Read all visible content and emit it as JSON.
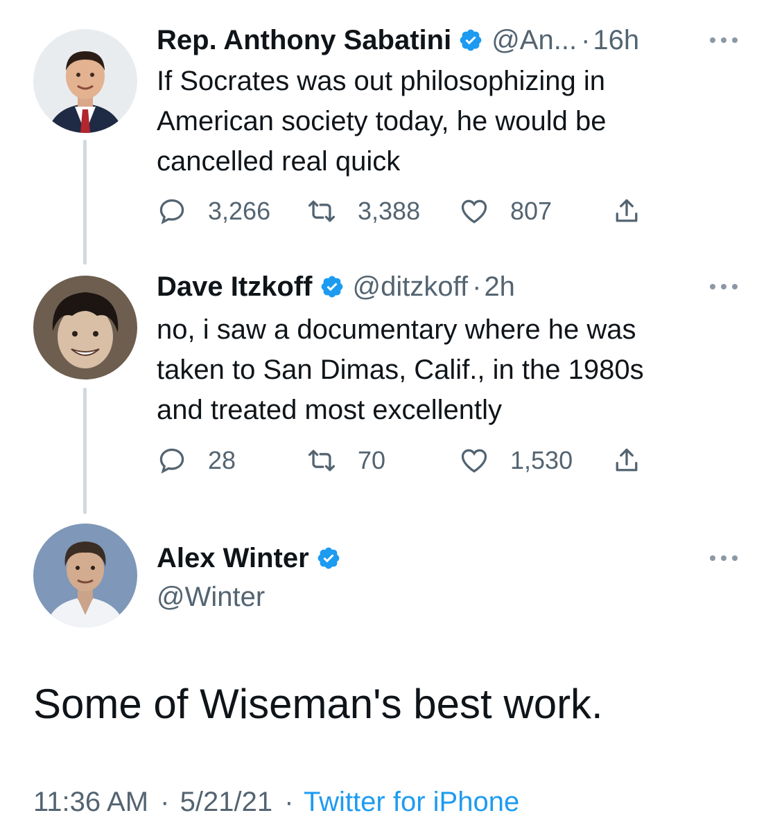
{
  "colors": {
    "verified": "#1d9bf0",
    "link": "#1d9bf0",
    "muted": "#536471",
    "thread_line": "#cfd9de"
  },
  "tweets": [
    {
      "name": "Rep. Anthony Sabatini",
      "handle": "@An...",
      "time": "16h",
      "text_lines": [
        "If Socrates was out philosophizing in",
        "American society today, he would be",
        "cancelled real quick"
      ],
      "replies": "3,266",
      "retweets": "3,388",
      "likes": "807"
    },
    {
      "name": "Dave Itzkoff",
      "handle": "@ditzkoff",
      "time": "2h",
      "text_lines": [
        "no, i saw a documentary where he was",
        "taken to San Dimas, Calif., in the 1980s",
        "and treated most excellently"
      ],
      "replies": "28",
      "retweets": "70",
      "likes": "1,530"
    }
  ],
  "main_tweet": {
    "name": "Alex Winter",
    "handle": "@Winter",
    "text": "Some of Wiseman's best work.",
    "time": "11:36 AM",
    "date": "5/21/21",
    "source": "Twitter for iPhone"
  },
  "icons": {
    "reply": "reply-icon",
    "retweet": "retweet-icon",
    "like": "heart-icon",
    "share": "share-icon",
    "verified": "verified-badge-icon",
    "more": "more-options-icon"
  }
}
